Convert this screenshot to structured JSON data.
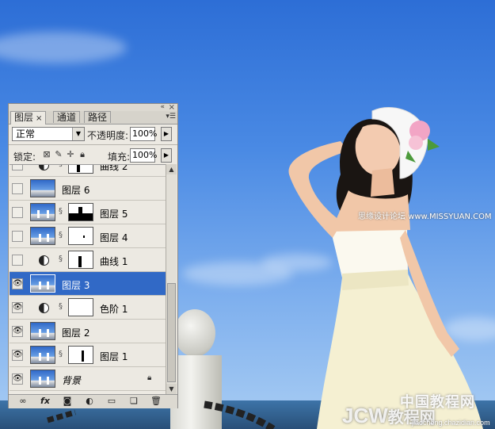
{
  "panel": {
    "tabs": [
      {
        "label": "图层",
        "close": "×"
      },
      {
        "label": "通道"
      },
      {
        "label": "路径"
      }
    ],
    "blend_mode": "正常",
    "opacity_label": "不透明度:",
    "opacity_value": "100%",
    "lock_label": "锁定:",
    "fill_label": "填充:",
    "fill_value": "100%",
    "layers": [
      {
        "name": "曲线 2",
        "visible": false
      },
      {
        "name": "图层 6",
        "visible": false
      },
      {
        "name": "图层 5",
        "visible": false
      },
      {
        "name": "图层 4",
        "visible": false
      },
      {
        "name": "曲线 1",
        "visible": false
      },
      {
        "name": "图层 3",
        "visible": true,
        "selected": true
      },
      {
        "name": "色阶 1",
        "visible": true
      },
      {
        "name": "图层 2",
        "visible": true
      },
      {
        "name": "图层 1",
        "visible": true
      },
      {
        "name": "背景",
        "visible": true,
        "locked": true
      }
    ]
  },
  "watermarks": {
    "site_cn": "思缘设计论坛 www.MISSYUAN.COM",
    "logo_cn": "中国教程网",
    "logo_big": "JCW",
    "logo_sub": "教程网",
    "url": "jiaocheng.chazidian.com"
  },
  "colors": {
    "selected_row": "#3169c6",
    "panel_bg": "#ece9e2",
    "sky_top": "#2d6ed6"
  }
}
